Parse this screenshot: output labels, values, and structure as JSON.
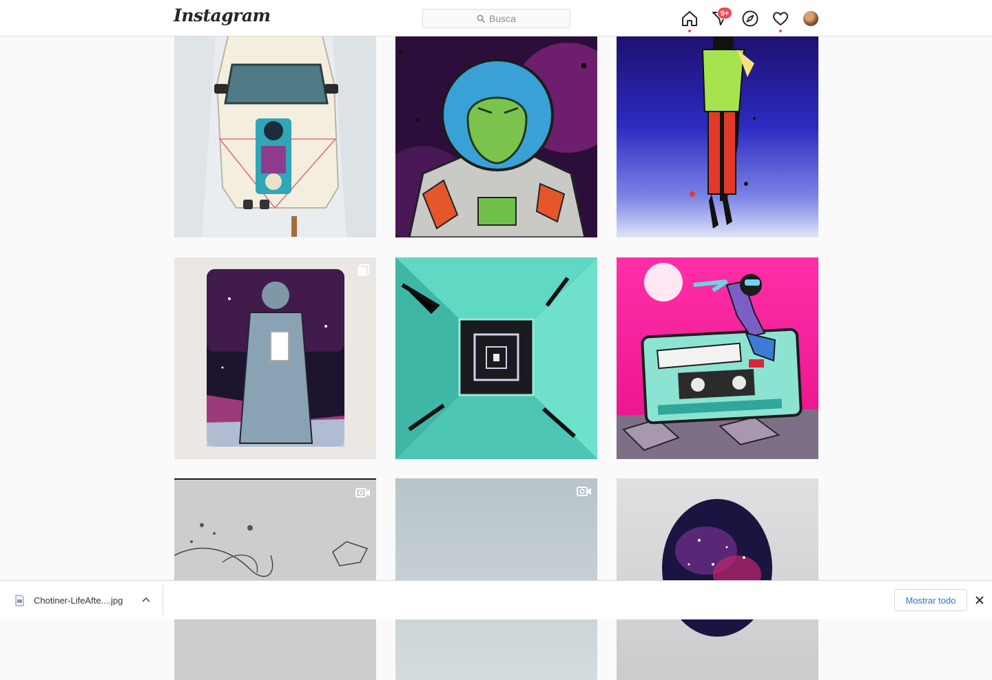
{
  "header": {
    "logo_text": "Instagram",
    "search_placeholder": "Busca",
    "direct_badge": "9+"
  },
  "icons": {
    "home": "home-icon",
    "direct": "direct-message-icon",
    "explore": "compass-icon",
    "activity": "heart-icon",
    "profile": "avatar"
  },
  "grid": {
    "posts": [
      {
        "art": "car-hood-art-in-snow",
        "overlay": ""
      },
      {
        "art": "astronaut-helmet-art",
        "overlay": ""
      },
      {
        "art": "figure-on-blue-background",
        "overlay": ""
      },
      {
        "art": "light-switch-plate-art",
        "overlay": "multiple-posts-icon"
      },
      {
        "art": "tunnel-art",
        "overlay": ""
      },
      {
        "art": "cassette-tape-art",
        "overlay": ""
      },
      {
        "art": "sketch-video",
        "overlay": "video-icon"
      },
      {
        "art": "grey-video",
        "overlay": "video-icon"
      },
      {
        "art": "galaxy-egg-art",
        "overlay": ""
      }
    ]
  },
  "download_bar": {
    "file_name": "Chotiner-LifeAfte....jpg",
    "show_all_label": "Mostrar todo"
  },
  "colors": {
    "notification_red": "#ed4956",
    "link_blue": "#2f6fd1",
    "page_bg": "#fafafa"
  }
}
